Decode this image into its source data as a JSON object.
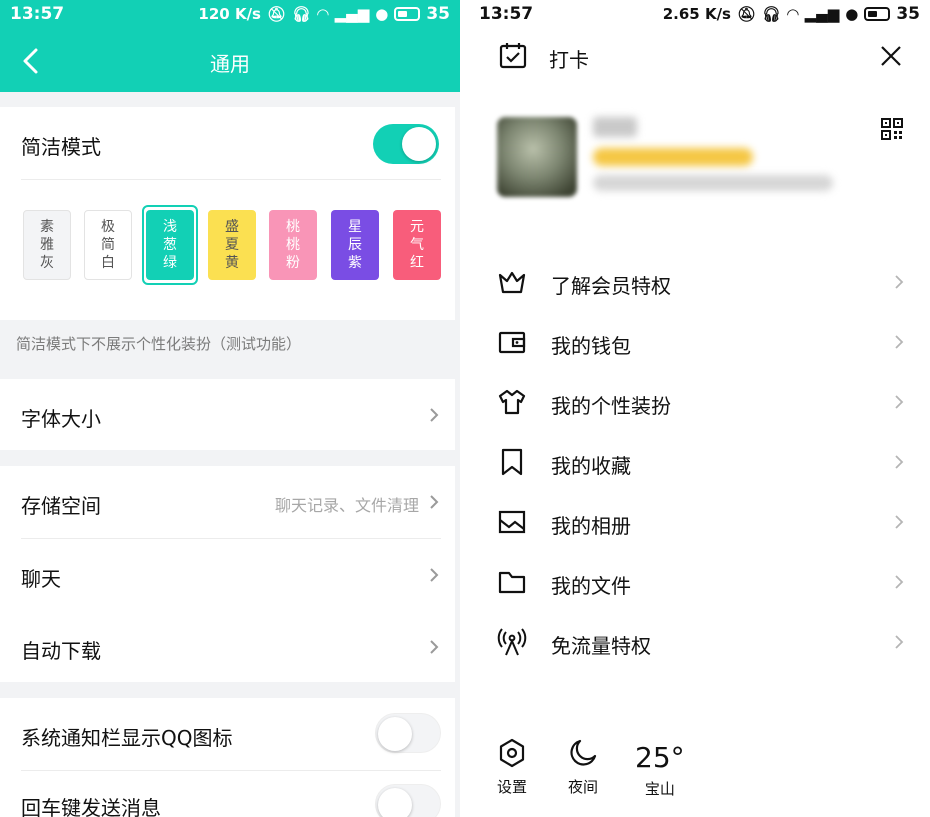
{
  "left": {
    "status": {
      "time": "13:57",
      "speed": "120 K/s",
      "battery": "35"
    },
    "nav": {
      "title": "通用"
    },
    "simple_mode": {
      "label": "简洁模式",
      "enabled": true
    },
    "themes": [
      {
        "lines": [
          "素",
          "雅",
          "灰"
        ],
        "bg": "#f3f4f6",
        "fg": "#555555"
      },
      {
        "lines": [
          "极",
          "简",
          "白"
        ],
        "bg": "#ffffff",
        "fg": "#555555"
      },
      {
        "lines": [
          "浅",
          "葱",
          "绿"
        ],
        "bg": "#12d0b5",
        "fg": "#ffffff"
      },
      {
        "lines": [
          "盛",
          "夏",
          "黄"
        ],
        "bg": "#fbe051",
        "fg": "#555555"
      },
      {
        "lines": [
          "桃",
          "桃",
          "粉"
        ],
        "bg": "#f995b7",
        "fg": "#ffffff"
      },
      {
        "lines": [
          "星",
          "辰",
          "紫"
        ],
        "bg": "#7a4de4",
        "fg": "#ffffff"
      },
      {
        "lines": [
          "元",
          "气",
          "红"
        ],
        "bg": "#f85d7b",
        "fg": "#ffffff"
      }
    ],
    "note": "简洁模式下不展示个性化装扮（测试功能）",
    "font_size": {
      "label": "字体大小"
    },
    "storage": {
      "label": "存储空间",
      "hint": "聊天记录、文件清理"
    },
    "chat": {
      "label": "聊天"
    },
    "auto_download": {
      "label": "自动下载"
    },
    "notif_icon": {
      "label": "系统通知栏显示QQ图标",
      "enabled": false
    },
    "enter_send": {
      "label": "回车键发送消息",
      "enabled": false
    }
  },
  "right": {
    "status": {
      "time": "13:57",
      "speed": "2.65 K/s",
      "battery": "35"
    },
    "checkin": {
      "label": "打卡"
    },
    "menu": [
      {
        "label": "了解会员特权",
        "icon": "crown-icon"
      },
      {
        "label": "我的钱包",
        "icon": "wallet-icon"
      },
      {
        "label": "我的个性装扮",
        "icon": "tshirt-icon"
      },
      {
        "label": "我的收藏",
        "icon": "bookmark-icon"
      },
      {
        "label": "我的相册",
        "icon": "album-icon"
      },
      {
        "label": "我的文件",
        "icon": "folder-icon"
      },
      {
        "label": "免流量特权",
        "icon": "signal-tower-icon"
      }
    ],
    "bottom": {
      "settings": "设置",
      "night": "夜间",
      "temperature": "25°",
      "city": "宝山"
    }
  },
  "colors": {
    "accent": "#12d0b5"
  }
}
